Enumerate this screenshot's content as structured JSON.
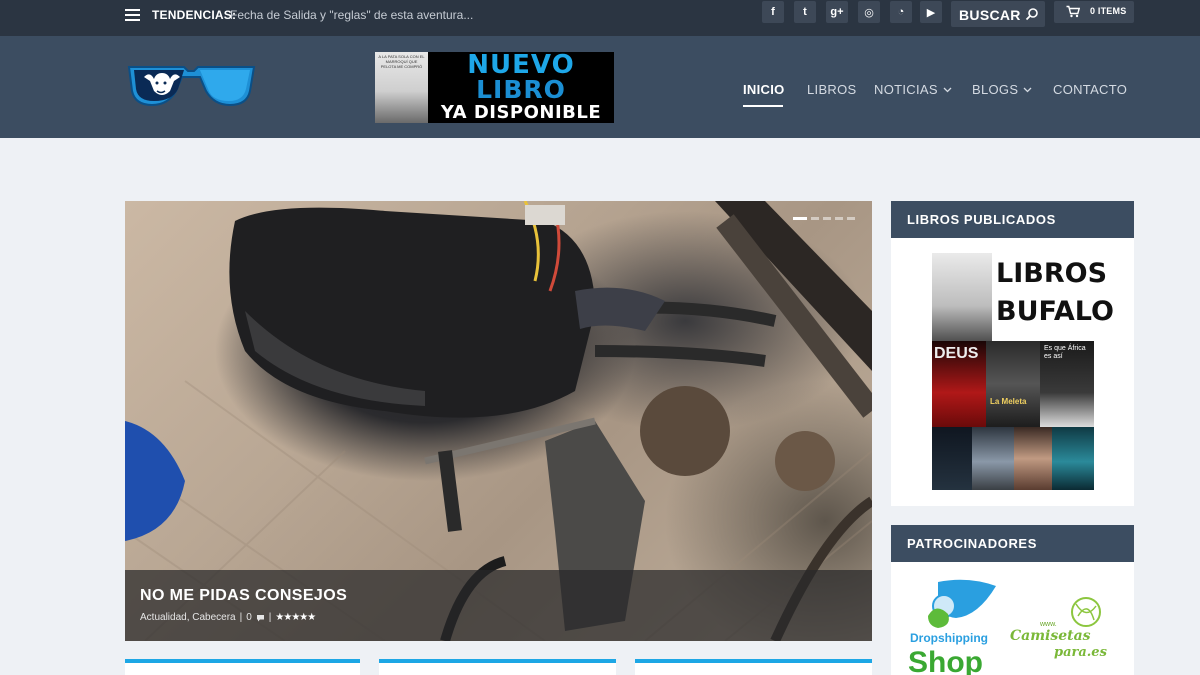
{
  "topbar": {
    "trending_label": "TENDENCIAS:",
    "trending_text": "Fecha de Salida y \"reglas\" de esta aventura...",
    "social": [
      {
        "icon": "facebook-icon",
        "glyph": "f"
      },
      {
        "icon": "twitter-icon",
        "glyph": "t"
      },
      {
        "icon": "google-plus-icon",
        "glyph": "g+"
      },
      {
        "icon": "instagram-icon",
        "glyph": "◎"
      },
      {
        "icon": "rss-icon",
        "glyph": "◔"
      },
      {
        "icon": "youtube-icon",
        "glyph": "▶"
      }
    ],
    "search_label": "BUSCAR",
    "cart_label": "0 ITEMS"
  },
  "banner": {
    "thumb_text": "A LA PATA SOLA CON EL MARROQUÍ QUE PELOTA ME COMPRÓ",
    "line1": "NUEVO",
    "line2": "LIBRO",
    "line3": "YA DISPONIBLE"
  },
  "nav": {
    "items": [
      {
        "label": "INICIO",
        "active": true,
        "dropdown": false
      },
      {
        "label": "LIBROS",
        "active": false,
        "dropdown": false
      },
      {
        "label": "NOTICIAS",
        "active": false,
        "dropdown": true
      },
      {
        "label": "BLOGS",
        "active": false,
        "dropdown": true
      },
      {
        "label": "CONTACTO",
        "active": false,
        "dropdown": false
      }
    ]
  },
  "slider": {
    "slide_count": 5,
    "active_slide": 1,
    "title": "NO ME PIDAS CONSEJOS",
    "categories": "Actualidad, Cabecera",
    "comments": "0",
    "separator": "|",
    "rating": 5
  },
  "sidebar": {
    "books_title": "LIBROS PUBLICADOS",
    "books_heading_1": "LIBROS",
    "books_heading_2": "BUFALO",
    "book_titles": [
      "DEUS",
      "La Meleta",
      "Es que África es así"
    ],
    "sponsors_title": "PATROCINADORES",
    "sponsor_1_a": "Dropshipping",
    "sponsor_1_b": "Shop",
    "sponsor_2_a": "www.",
    "sponsor_2_b": "Camisetas",
    "sponsor_2_c": "para.es"
  },
  "colors": {
    "topbar": "#2b3542",
    "header": "#3c4d61",
    "accent": "#1da7e5",
    "page_bg": "#eef1f5"
  }
}
